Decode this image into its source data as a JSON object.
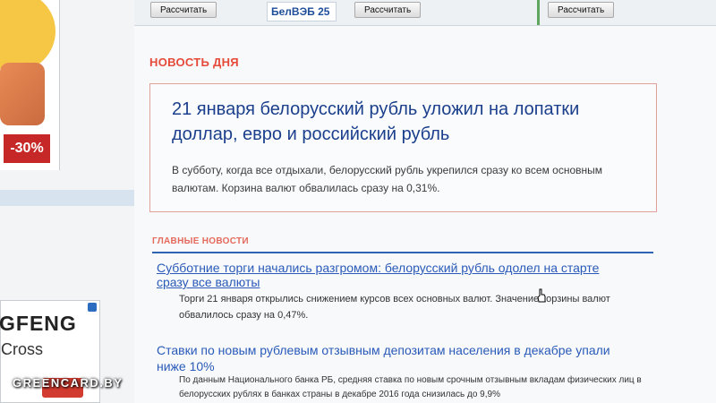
{
  "left_ads": {
    "discount_badge": "-30%",
    "bottom_ad_brand": "GFENG",
    "bottom_ad_model": "Cross"
  },
  "top_strip": {
    "calc_button_1": "Рассчитать",
    "calc_button_2": "Рассчитать",
    "calc_button_3": "Рассчитать",
    "logo_text": "БелВЭБ 25"
  },
  "news_of_day": {
    "section_label": "НОВОСТЬ ДНЯ",
    "headline": "21 января белорусский рубль уложил на лопатки доллар, евро и российский рубль",
    "lead": "В субботу, когда все отдыхали, белорусский рубль укрепился сразу ко всем основным валютам. Корзина валют обвалилась сразу на 0,31%."
  },
  "main_news": {
    "section_label": "ГЛАВНЫЕ НОВОСТИ",
    "items": [
      {
        "title": "Субботние торги начались разгромом: белорусский рубль одолел на старте сразу все валюты",
        "desc": "Торги 21 января открылись снижением курсов всех основных валют. Значение корзины валют обвалилось сразу на 0,47%."
      },
      {
        "title": "Ставки по новым рублевым отзывным депозитам населения в декабре упали ниже 10%",
        "desc": "По данным Национального банка РБ, средняя ставка по новым срочным отзывным вкладам физических лиц в белорусских рублях в банках страны в декабре 2016 года снизилась до 9,9%"
      }
    ]
  },
  "watermark": "GREENCARD.BY",
  "colors": {
    "section_red": "#e54a3a",
    "headline_blue": "#1b3f8c",
    "link_blue": "#2a5ab8",
    "rule_blue": "#2f63b3"
  }
}
